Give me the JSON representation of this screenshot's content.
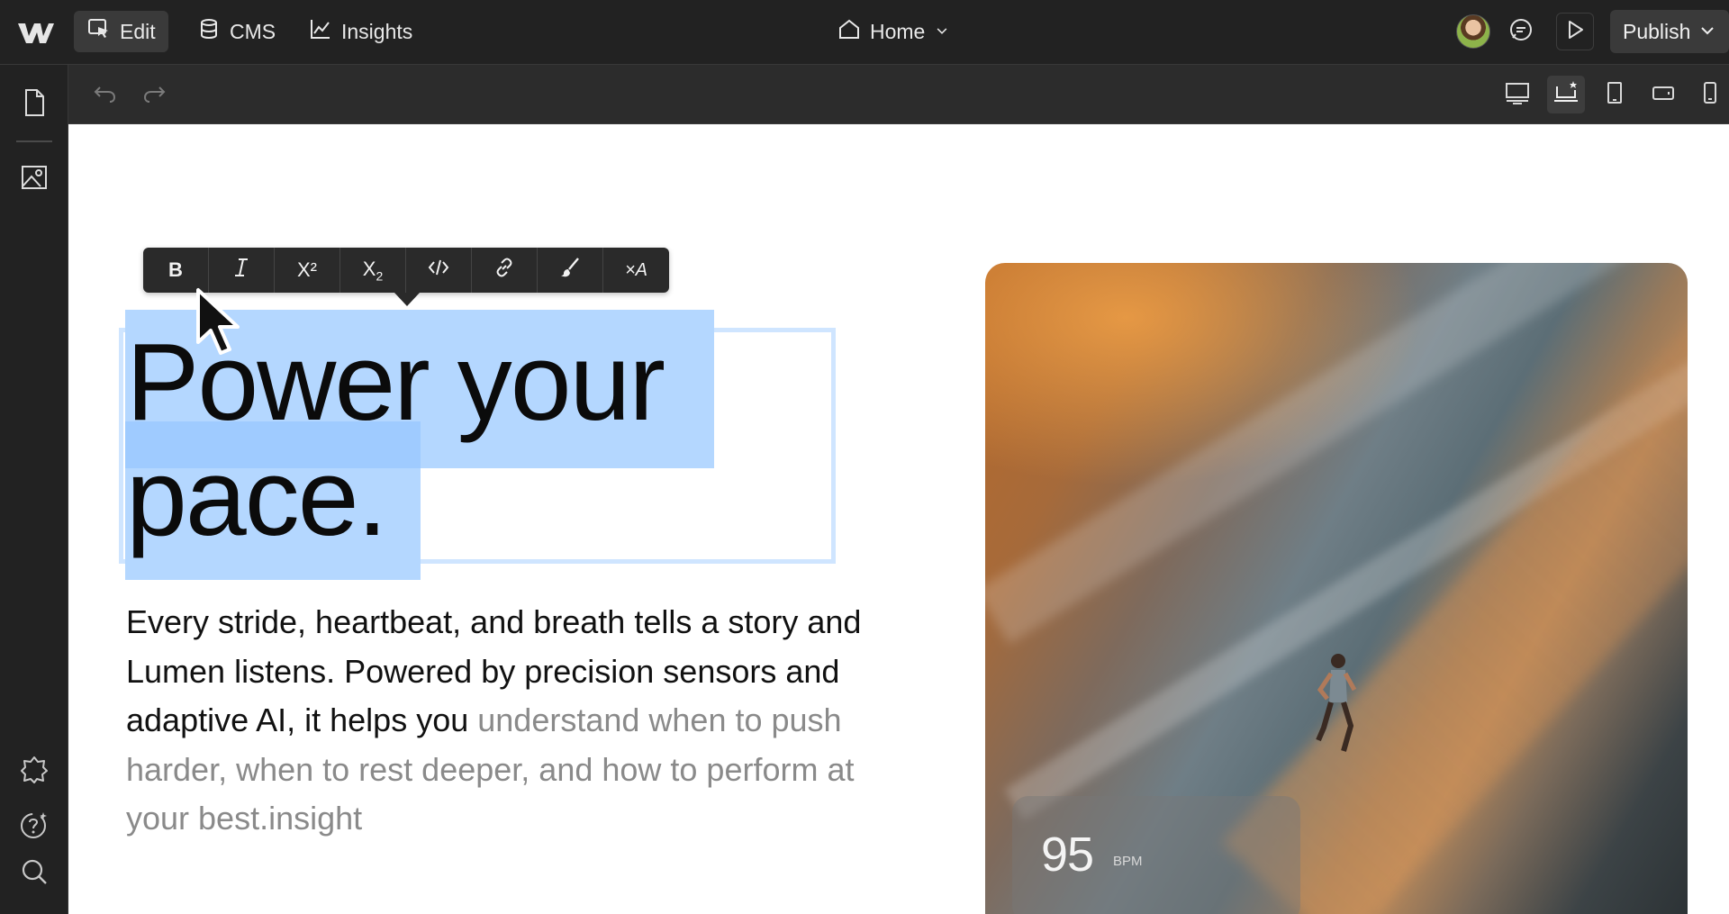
{
  "topbar": {
    "edit_label": "Edit",
    "cms_label": "CMS",
    "insights_label": "Insights",
    "page_label": "Home",
    "publish_label": "Publish"
  },
  "rte_toolbar": {
    "bold": "B",
    "superscript": "X²",
    "subscript_base": "X",
    "subscript_sub": "2",
    "clear_format": "×A"
  },
  "canvas": {
    "headline_line1": "Power your",
    "headline_line2": "pace.",
    "body_dark": "Every stride, heartbeat, and breath tells a story and Lumen listens. Powered by precision sensors and adaptive AI, it helps you",
    "body_faded": "understand when to push harder, when to rest deeper, and how to perform at your best.insight",
    "bpm_value": "95",
    "bpm_unit": "BPM"
  },
  "colors": {
    "chrome": "#222222",
    "toolbar": "#2c2c2c",
    "selection": "#b4d7ff",
    "selection_frame": "#cfe5ff"
  }
}
